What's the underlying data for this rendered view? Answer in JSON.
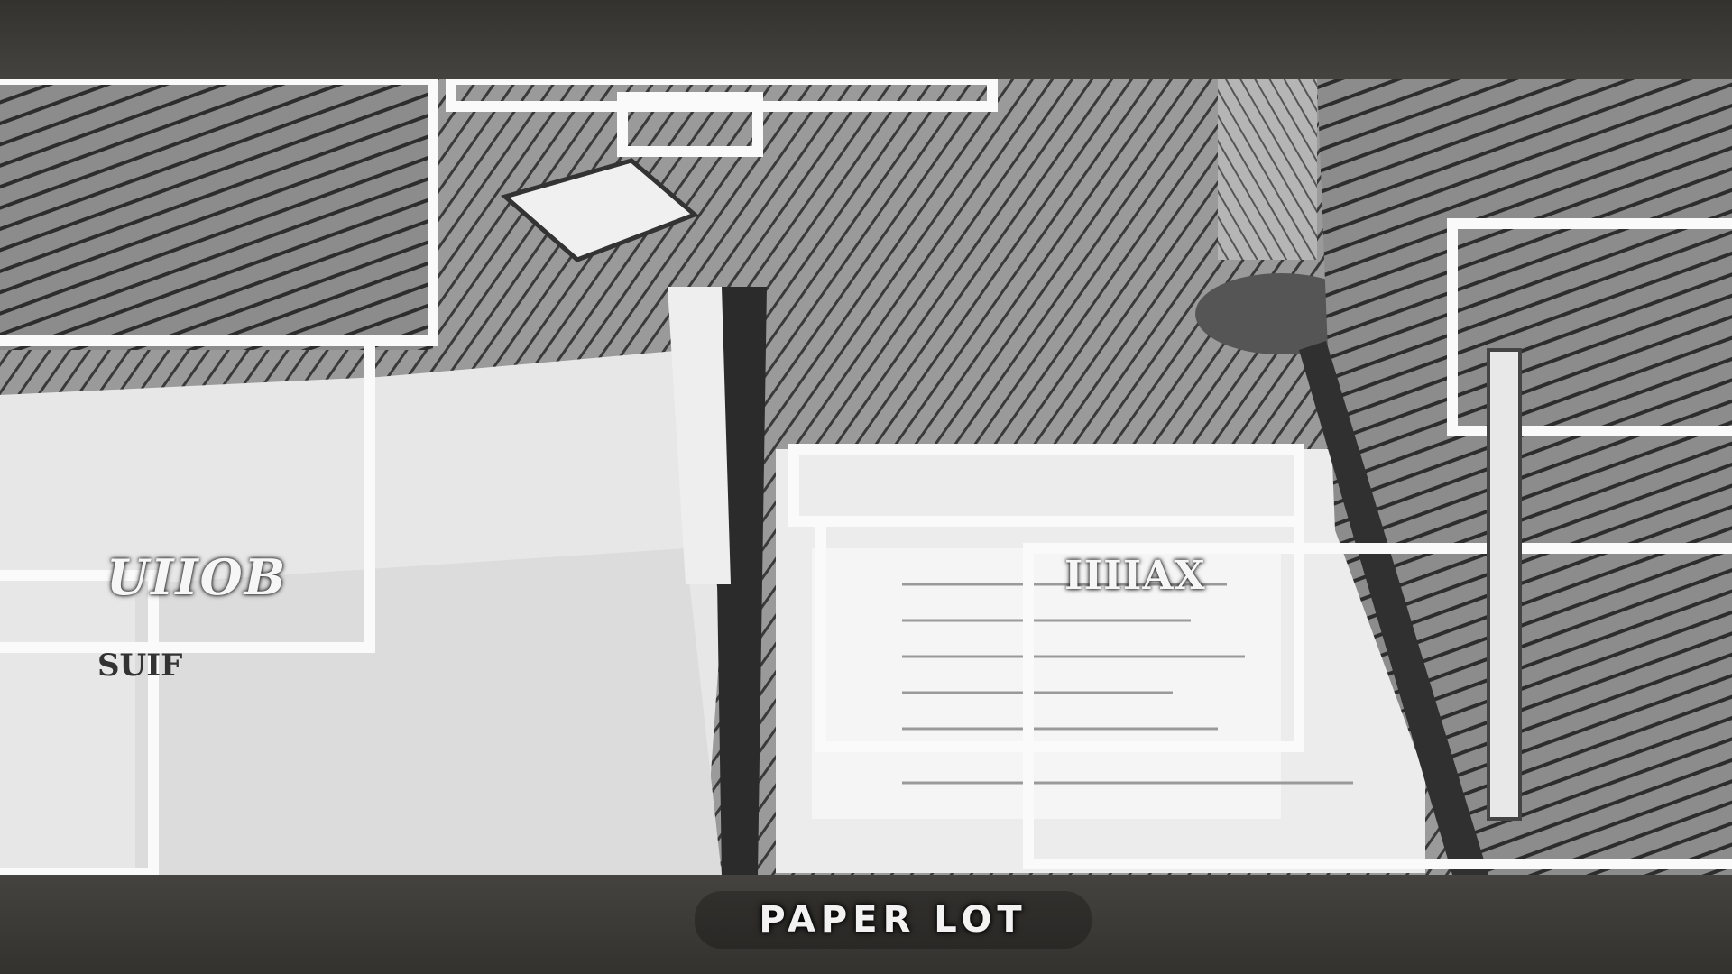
{
  "scene": {
    "description_style": "sketch-filtered photo",
    "caption": "PAPER LOT",
    "sign_text_left": "UIIOB",
    "sign_text_left_sub": "SUIF",
    "sign_text_center": "IIIIAX"
  },
  "colors": {
    "band": "#3b3935",
    "photo_base": "#d6d6d6"
  }
}
